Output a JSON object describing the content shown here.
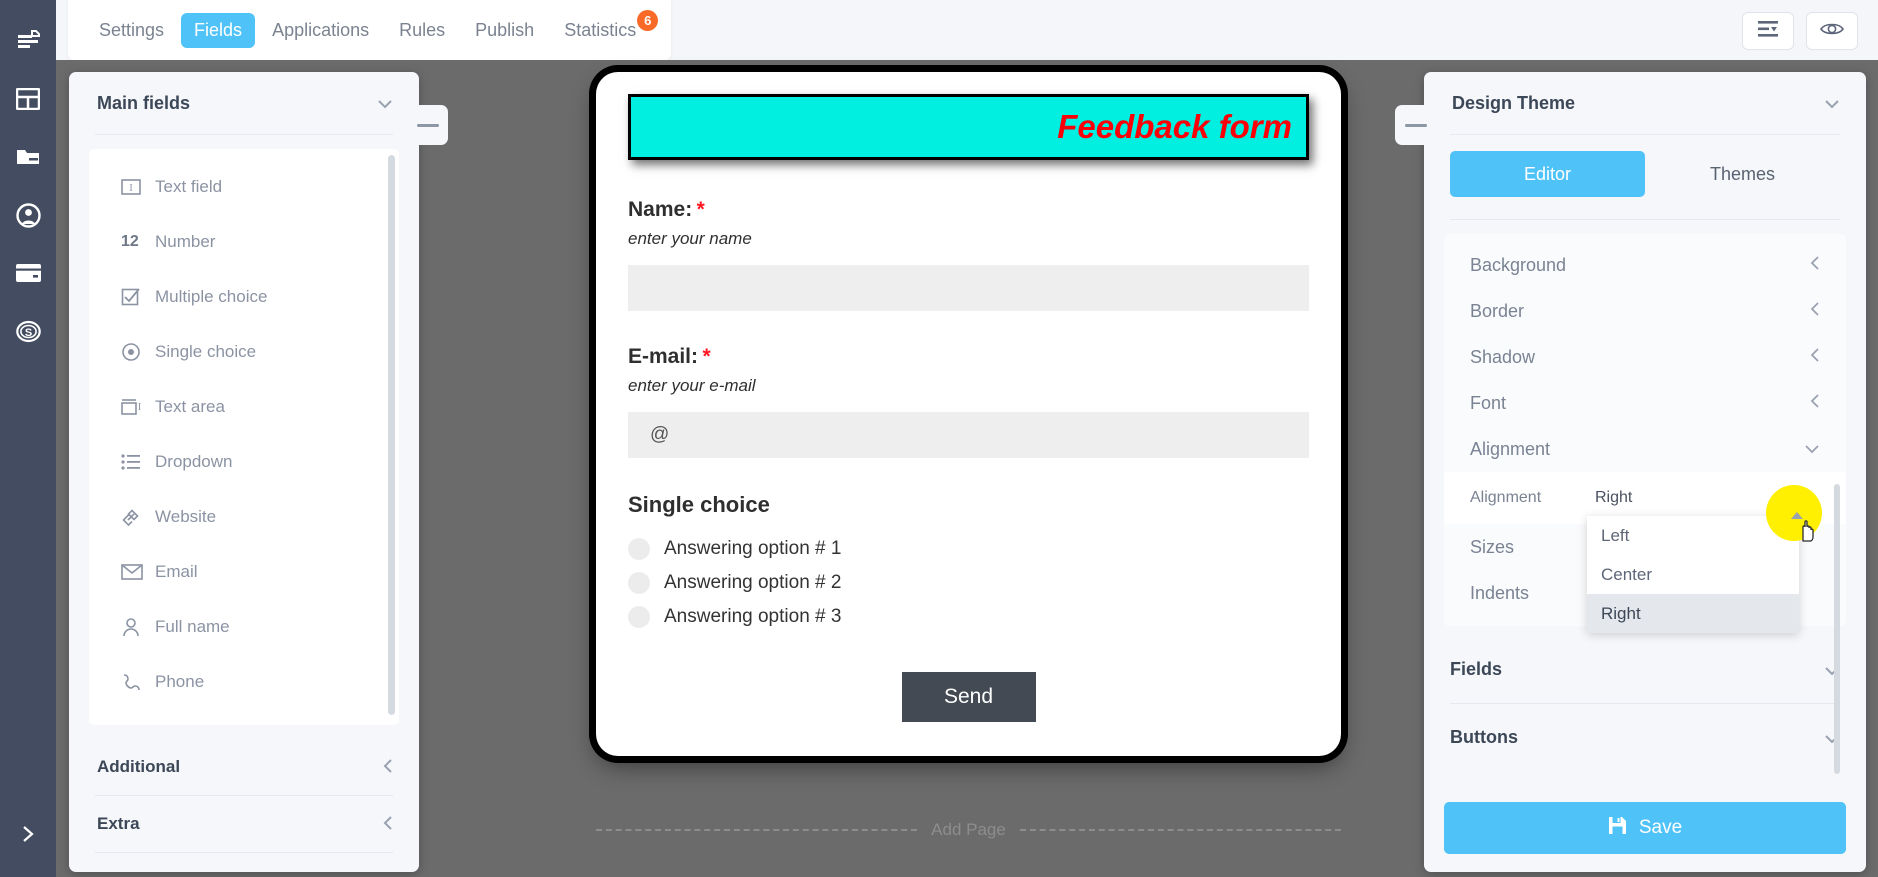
{
  "rail": {
    "items": [
      {
        "icon": "forms-icon",
        "name": "rail-item-forms"
      },
      {
        "icon": "layout-icon",
        "name": "rail-item-layout"
      },
      {
        "icon": "folder-icon",
        "name": "rail-item-folder"
      },
      {
        "icon": "account-icon",
        "name": "rail-item-account"
      },
      {
        "icon": "card-icon",
        "name": "rail-item-card"
      },
      {
        "icon": "dollar-icon",
        "name": "rail-item-billing"
      }
    ],
    "expand_icon": "chevron-right-icon"
  },
  "topbar": {
    "tabs": [
      {
        "label": "Settings",
        "active": false,
        "badge": null
      },
      {
        "label": "Fields",
        "active": true,
        "badge": null
      },
      {
        "label": "Applications",
        "active": false,
        "badge": null
      },
      {
        "label": "Rules",
        "active": false,
        "badge": null
      },
      {
        "label": "Publish",
        "active": false,
        "badge": null
      },
      {
        "label": "Statistics",
        "active": false,
        "badge": "6"
      }
    ],
    "actions": [
      {
        "icon": "list-settings-icon",
        "name": "list-settings-button"
      },
      {
        "icon": "eye-icon",
        "name": "preview-button"
      }
    ]
  },
  "fields_panel": {
    "title": "Main fields",
    "chevron": "chevron-down-icon",
    "collapse_icon": "minus-icon",
    "items": [
      {
        "label": "Text field",
        "icon": "text-field-icon"
      },
      {
        "label": "Number",
        "icon": "number-icon",
        "glyph": "12"
      },
      {
        "label": "Multiple choice",
        "icon": "checkbox-icon"
      },
      {
        "label": "Single choice",
        "icon": "radio-icon"
      },
      {
        "label": "Text area",
        "icon": "text-area-icon"
      },
      {
        "label": "Dropdown",
        "icon": "list-icon"
      },
      {
        "label": "Website",
        "icon": "link-icon"
      },
      {
        "label": "Email",
        "icon": "envelope-icon"
      },
      {
        "label": "Full name",
        "icon": "person-icon"
      },
      {
        "label": "Phone",
        "icon": "phone-icon"
      }
    ],
    "sections": [
      {
        "label": "Additional",
        "chevron": "chevron-left-icon"
      },
      {
        "label": "Extra",
        "chevron": "chevron-left-icon"
      }
    ]
  },
  "form": {
    "title": "Feedback form",
    "title_bg": "#00efe0",
    "title_color": "#fb0007",
    "blocks": [
      {
        "label": "Name:",
        "required": "*",
        "hint": "enter your name",
        "value": ""
      },
      {
        "label": "E-mail:",
        "required": "*",
        "hint": "enter your e-mail",
        "value": "@"
      }
    ],
    "single_choice": {
      "title": "Single choice",
      "options": [
        "Answering option # 1",
        "Answering option # 2",
        "Answering option # 3"
      ]
    },
    "submit_label": "Send",
    "add_page_label": "Add Page"
  },
  "design_panel": {
    "title": "Design Theme",
    "chevron": "chevron-down-icon",
    "collapse_icon": "minus-icon",
    "tabs": [
      {
        "label": "Editor",
        "active": true
      },
      {
        "label": "Themes",
        "active": false
      }
    ],
    "settings": [
      {
        "label": "Background",
        "chevron": "chevron-left-icon"
      },
      {
        "label": "Border",
        "chevron": "chevron-left-icon"
      },
      {
        "label": "Shadow",
        "chevron": "chevron-left-icon"
      },
      {
        "label": "Font",
        "chevron": "chevron-left-icon"
      },
      {
        "label": "Alignment",
        "chevron": "chevron-down-icon"
      }
    ],
    "alignment": {
      "label": "Alignment",
      "value": "Right",
      "options": [
        "Left",
        "Center",
        "Right"
      ],
      "selected": "Right"
    },
    "settings_after": [
      {
        "label": "Sizes"
      },
      {
        "label": "Indents"
      }
    ],
    "groups": [
      {
        "label": "Fields",
        "chevron": "chevron-down-icon"
      },
      {
        "label": "Buttons",
        "chevron": "chevron-down-icon"
      }
    ],
    "save_label": "Save",
    "save_icon": "floppy-disk-icon",
    "accent_color": "#4fc3f7"
  }
}
